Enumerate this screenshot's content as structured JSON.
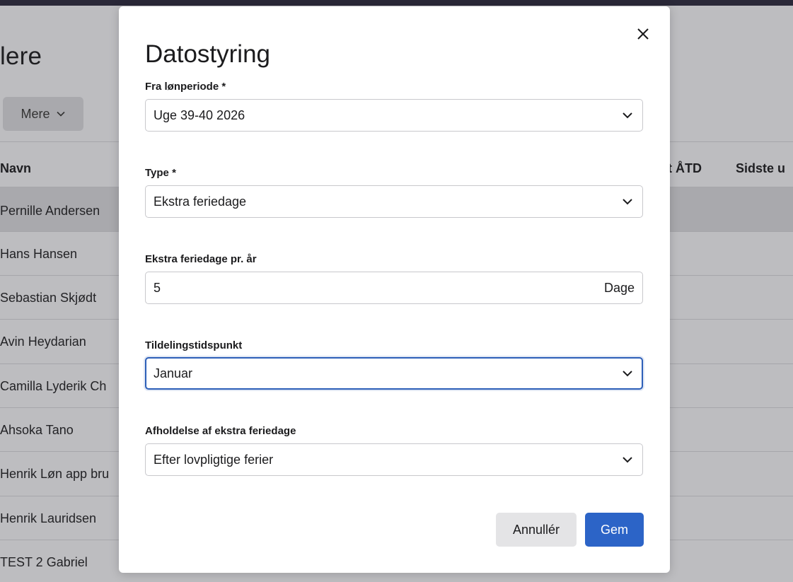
{
  "background": {
    "page_title": "lere",
    "more_button_label": "Mere",
    "table_headers": {
      "name": "Navn",
      "col_atd": "t ÅTD",
      "col_last": "Sidste u"
    },
    "rows": [
      "Pernille Andersen",
      "Hans Hansen",
      "Sebastian Skjødt",
      "Avin Heydarian",
      "Camilla Lyderik Ch",
      "Ahsoka Tano",
      "Henrik Løn app bru",
      "Henrik Lauridsen",
      "TEST 2 Gabriel"
    ]
  },
  "modal": {
    "title": "Datostyring",
    "fields": {
      "pay_period": {
        "label": "Fra lønperiode *",
        "value": "Uge 39-40 2026"
      },
      "type": {
        "label": "Type *",
        "value": "Ekstra feriedage"
      },
      "extra_days": {
        "label": "Ekstra feriedage pr. år",
        "value": "5",
        "suffix": "Dage"
      },
      "allocation_time": {
        "label": "Tildelingstidspunkt",
        "value": "Januar"
      },
      "usage": {
        "label": "Afholdelse af ekstra feriedage",
        "value": "Efter lovpligtige ferier"
      }
    },
    "buttons": {
      "cancel": "Annullér",
      "save": "Gem"
    }
  },
  "colors": {
    "primary": "#2c64c7",
    "focus_border": "#2d5fb8",
    "overlay_bg": "#bdbdc0",
    "top_bar": "#2a2838"
  }
}
